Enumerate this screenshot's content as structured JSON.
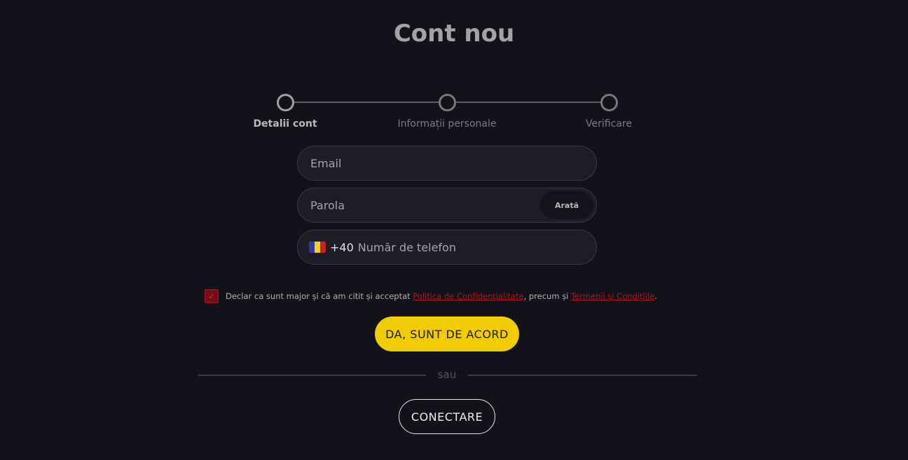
{
  "title": "Cont nou",
  "steps": [
    {
      "label": "Detalii cont",
      "active": true
    },
    {
      "label": "Informații personale",
      "active": false
    },
    {
      "label": "Verificare",
      "active": false
    }
  ],
  "form": {
    "email_placeholder": "Email",
    "email_value": "",
    "password_placeholder": "Parola",
    "password_value": "",
    "show_password_label": "Arată",
    "phone_country_flag": "romania-flag-icon",
    "phone_dial_code": "+40",
    "phone_placeholder": "Număr de telefon",
    "phone_value": ""
  },
  "consent": {
    "checked": true,
    "text_before": "Declar ca sunt major și că am citit și acceptat ",
    "privacy_link": "Politica de Confidențialitate",
    "text_middle": ", precum și ",
    "terms_link": "Termenii și Condițiile",
    "text_after": "."
  },
  "agree_button": "DA, SUNT DE ACORD",
  "divider_text": "sau",
  "login_button": "CONECTARE",
  "colors": {
    "background": "#12121b",
    "accent": "#f0cc00",
    "link": "#b3141f",
    "checkbox": "#7a0c16"
  }
}
